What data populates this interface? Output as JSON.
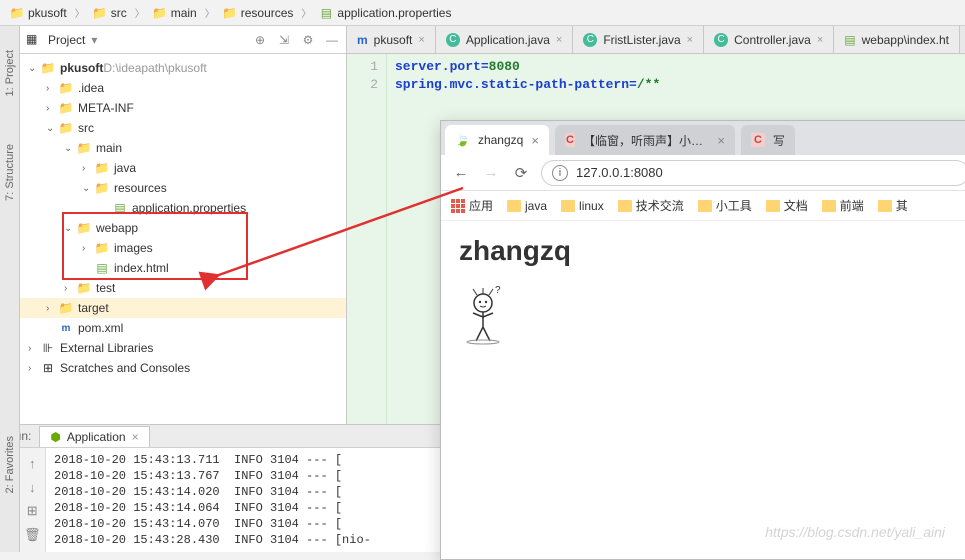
{
  "breadcrumb": [
    {
      "icon": "mod",
      "label": "pkusoft"
    },
    {
      "icon": "mod",
      "label": "src"
    },
    {
      "icon": "mod",
      "label": "main"
    },
    {
      "icon": "res",
      "label": "resources"
    },
    {
      "icon": "prop",
      "label": "application.properties"
    }
  ],
  "project_panel": {
    "title": "Project",
    "tools": [
      "sync",
      "collapse",
      "gear",
      "hide"
    ]
  },
  "side_tabs": [
    "1: Project",
    "7: Structure",
    "2: Favorites"
  ],
  "tree": [
    {
      "depth": 0,
      "arrow": "v",
      "icon": "mod",
      "label": "pkusoft",
      "suffix": " D:\\ideapath\\pkusoft",
      "bold": true
    },
    {
      "depth": 1,
      "arrow": ">",
      "icon": "folder",
      "label": ".idea"
    },
    {
      "depth": 1,
      "arrow": ">",
      "icon": "folder",
      "label": "META-INF"
    },
    {
      "depth": 1,
      "arrow": "v",
      "icon": "mod",
      "label": "src"
    },
    {
      "depth": 2,
      "arrow": "v",
      "icon": "mod",
      "label": "main"
    },
    {
      "depth": 3,
      "arrow": ">",
      "icon": "mod",
      "label": "java"
    },
    {
      "depth": 3,
      "arrow": "v",
      "icon": "res",
      "label": "resources"
    },
    {
      "depth": 4,
      "arrow": "",
      "icon": "prop",
      "label": "application.properties"
    },
    {
      "depth": 2,
      "arrow": "v",
      "icon": "mod",
      "label": "webapp"
    },
    {
      "depth": 3,
      "arrow": ">",
      "icon": "folder",
      "label": "images"
    },
    {
      "depth": 3,
      "arrow": "",
      "icon": "html",
      "label": "index.html"
    },
    {
      "depth": 2,
      "arrow": ">",
      "icon": "mod",
      "label": "test"
    },
    {
      "depth": 1,
      "arrow": ">",
      "icon": "target",
      "label": "target",
      "target": true
    },
    {
      "depth": 1,
      "arrow": "",
      "icon": "pom",
      "label": "pom.xml"
    },
    {
      "depth": 0,
      "arrow": ">",
      "icon": "lib",
      "label": "External Libraries"
    },
    {
      "depth": 0,
      "arrow": ">",
      "icon": "scratch",
      "label": "Scratches and Consoles"
    }
  ],
  "editor_tabs": [
    {
      "icon": "m",
      "label": "pkusoft",
      "close": true
    },
    {
      "icon": "c",
      "label": "Application.java",
      "close": true
    },
    {
      "icon": "c",
      "label": "FristLister.java",
      "close": true
    },
    {
      "icon": "c",
      "label": "Controller.java",
      "close": true
    },
    {
      "icon": "html",
      "label": "webapp\\index.ht",
      "close": false
    }
  ],
  "code_lines": [
    {
      "num": "1",
      "raw": "server.port=8080",
      "k": "server.port",
      "v": "8080"
    },
    {
      "num": "2",
      "raw": "spring.mvc.static-path-pattern=/**",
      "k": "spring.mvc.static-path-pattern",
      "v": "/**"
    }
  ],
  "browser": {
    "tabs": [
      {
        "label": "zhangzq",
        "active": true,
        "icon": "leaf"
      },
      {
        "label": "【临窗，听雨声】小菜鸟 - CSDN",
        "active": false,
        "icon": "c"
      },
      {
        "label": "写",
        "active": false,
        "icon": "c"
      }
    ],
    "nav": {
      "back": "←",
      "fwd": "→",
      "reload": "⟳"
    },
    "url": "127.0.0.1:8080",
    "apps_label": "应用",
    "bookmarks": [
      "java",
      "linux",
      "技术交流",
      "小工具",
      "文档",
      "前端",
      "其"
    ],
    "page_title": "zhangzq"
  },
  "run": {
    "label": "Run:",
    "tab": "Application",
    "tools": [
      "rerun",
      "up",
      "stop",
      "down",
      "pause",
      "layout",
      "settings",
      "trash"
    ],
    "log": [
      "2018-10-20 15:43:13.711  INFO 3104 --- [",
      "2018-10-20 15:43:13.767  INFO 3104 --- [",
      "2018-10-20 15:43:14.020  INFO 3104 --- [",
      "2018-10-20 15:43:14.064  INFO 3104 --- [",
      "2018-10-20 15:43:14.070  INFO 3104 --- [",
      "2018-10-20 15:43:28.430  INFO 3104 --- [nio-"
    ]
  },
  "watermark": "https://blog.csdn.net/yali_aini"
}
